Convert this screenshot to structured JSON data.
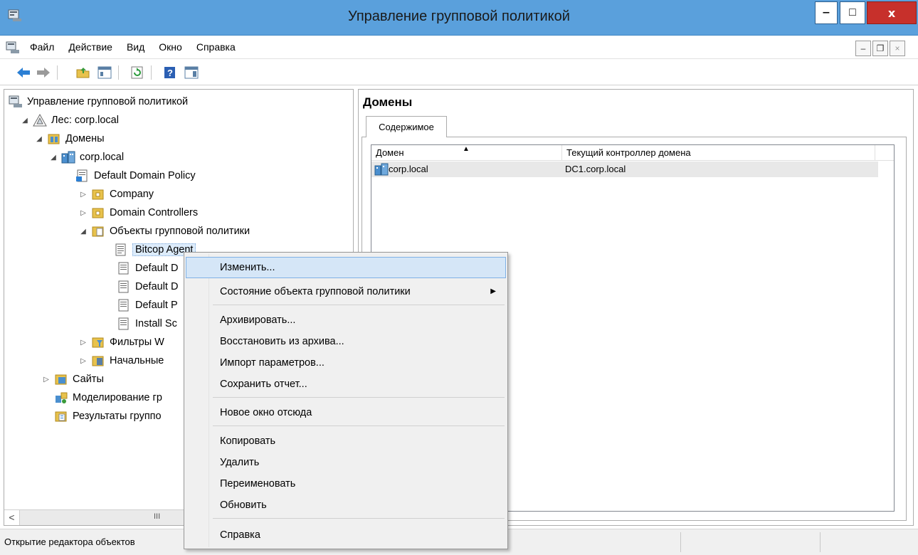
{
  "window": {
    "title": "Управление групповой политикой",
    "minimize": "‒",
    "maximize": "□",
    "close": "x"
  },
  "menubar": {
    "items": [
      "Файл",
      "Действие",
      "Вид",
      "Окно",
      "Справка"
    ]
  },
  "tree": {
    "items": [
      {
        "label": "Управление групповой политикой",
        "expander": ""
      },
      {
        "label": "Лес: corp.local",
        "expander": "◢"
      },
      {
        "label": "Домены",
        "expander": "◢"
      },
      {
        "label": "corp.local",
        "expander": "◢"
      },
      {
        "label": "Default Domain Policy",
        "expander": ""
      },
      {
        "label": "Company",
        "expander": "▷"
      },
      {
        "label": "Domain Controllers",
        "expander": "▷"
      },
      {
        "label": "Объекты групповой политики",
        "expander": "◢"
      },
      {
        "label": "Bitcop Agent",
        "expander": ""
      },
      {
        "label": "Default D",
        "expander": ""
      },
      {
        "label": "Default D",
        "expander": ""
      },
      {
        "label": "Default P",
        "expander": ""
      },
      {
        "label": "Install Sc",
        "expander": ""
      },
      {
        "label": "Фильтры W",
        "expander": "▷"
      },
      {
        "label": "Начальные",
        "expander": "▷"
      },
      {
        "label": "Сайты",
        "expander": "▷"
      },
      {
        "label": "Моделирование гр",
        "expander": ""
      },
      {
        "label": "Результаты группо",
        "expander": ""
      }
    ],
    "scroll_left": "<",
    "scroll_grip": "III"
  },
  "right_pane": {
    "heading": "Домены",
    "tab": "Содержимое",
    "columns": [
      "Домен",
      "Текущий контроллер домена"
    ],
    "sort_indicator": "▲",
    "rows": [
      {
        "domain": "corp.local",
        "controller": "DC1.corp.local"
      }
    ]
  },
  "context_menu": {
    "items": [
      {
        "label": "Изменить...",
        "submenu": ""
      },
      {
        "label": "Состояние объекта групповой политики",
        "submenu": "▶"
      },
      {
        "label": "Архивировать...",
        "submenu": ""
      },
      {
        "label": "Восстановить из архива...",
        "submenu": ""
      },
      {
        "label": "Импорт параметров...",
        "submenu": ""
      },
      {
        "label": "Сохранить отчет...",
        "submenu": ""
      },
      {
        "label": "Новое окно отсюда",
        "submenu": ""
      },
      {
        "label": "Копировать",
        "submenu": ""
      },
      {
        "label": "Удалить",
        "submenu": ""
      },
      {
        "label": "Переименовать",
        "submenu": ""
      },
      {
        "label": "Обновить",
        "submenu": ""
      },
      {
        "label": "Справка",
        "submenu": ""
      }
    ]
  },
  "statusbar": {
    "text": "Открытие редактора объектов"
  },
  "colors": {
    "titlebar": "#5aa0dc",
    "close_button": "#c7302b",
    "menu_hover": "#d5e6f7",
    "selection": "#ddecfb"
  }
}
